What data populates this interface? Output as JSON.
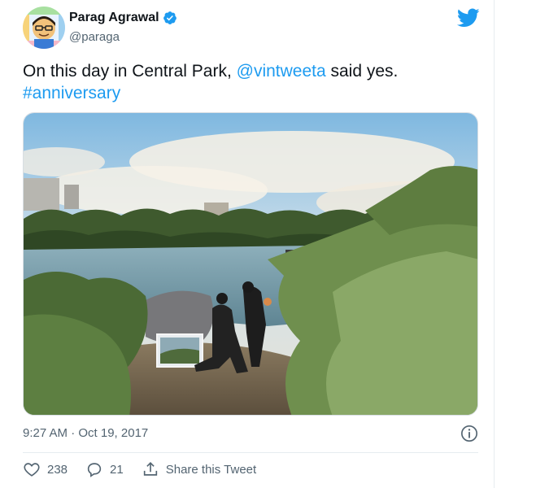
{
  "author": {
    "display_name": "Parag Agrawal",
    "handle": "@paraga",
    "verified_icon": "verified-badge-icon",
    "avatar_icon": "avatar"
  },
  "brand": {
    "logo_icon": "twitter-bird-icon",
    "color": "#1d9bf0"
  },
  "tweet": {
    "text_before": "On this day in Central Park, ",
    "mention": "@vintweeta",
    "text_after": " said yes.",
    "hashtag": "#anniversary",
    "timestamp": "9:27 AM · Oct 19, 2017"
  },
  "actions": {
    "like_count": "238",
    "reply_count": "21",
    "share_label": "Share this Tweet"
  },
  "colors": {
    "text": "#0f1419",
    "secondary": "#536471",
    "link": "#1d9bf0",
    "divider": "#e6ecf0"
  }
}
